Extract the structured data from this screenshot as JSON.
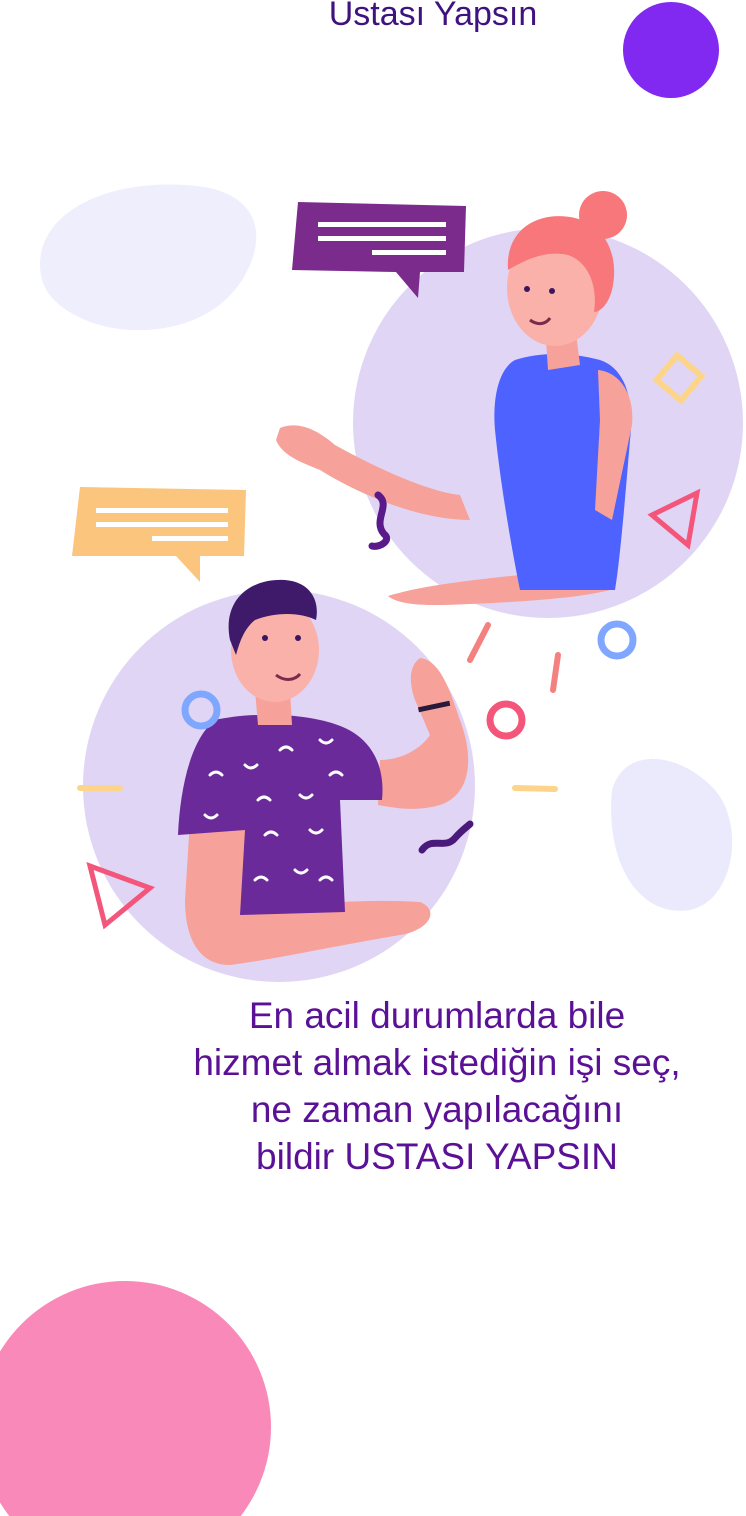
{
  "header": {
    "title": "Ustası Yapsın"
  },
  "tagline": {
    "lines": [
      "En acil durumlarda bile",
      "hizmet almak istediğin işi seç,",
      "ne zaman yapılacağını",
      "bildir USTASI YAPSIN"
    ]
  },
  "icons": {
    "top_right": "purple-circle-decoration",
    "bottom_left": "pink-circle-decoration",
    "woman": "woman-chat-illustration",
    "man": "man-chat-illustration"
  },
  "colors": {
    "brand_purple": "#5b1196",
    "title_purple": "#3f137f",
    "accent_violet": "#8129f0",
    "accent_pink": "#f989b8",
    "bubble_purple": "#7a2b8c",
    "bubble_yellow": "#fbc57e"
  }
}
